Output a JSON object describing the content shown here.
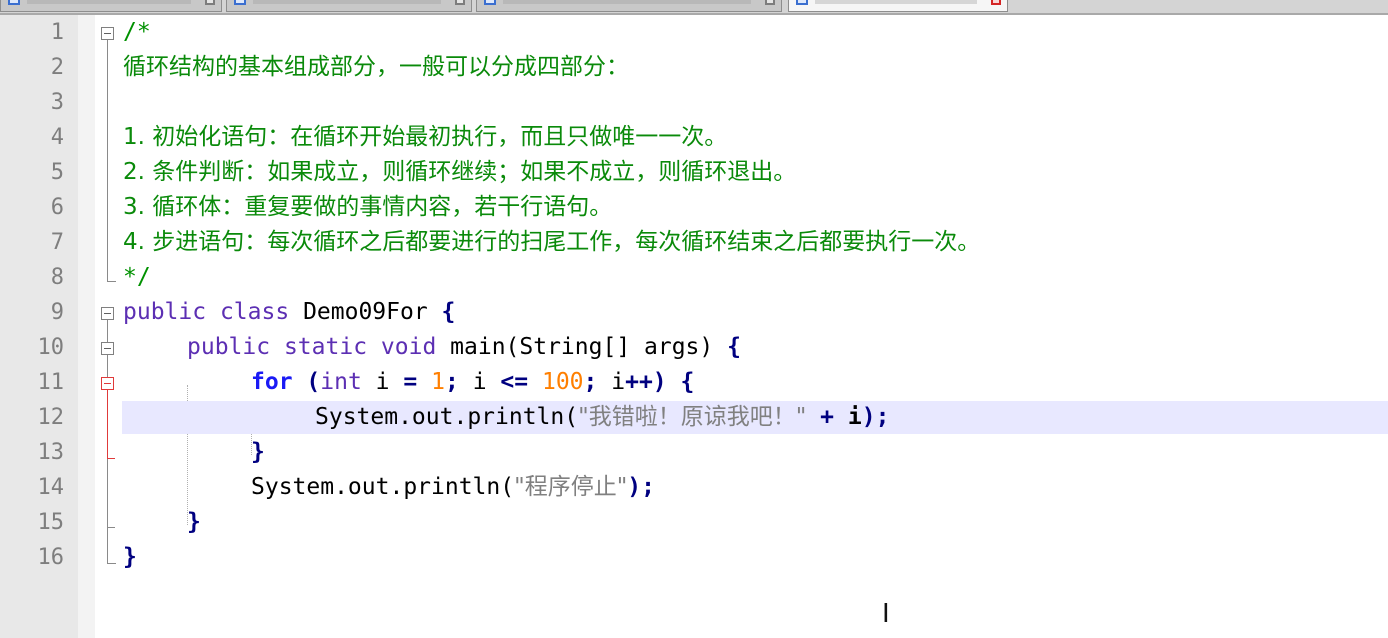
{
  "editor": {
    "lines": [
      {
        "n": "1"
      },
      {
        "n": "2"
      },
      {
        "n": "3"
      },
      {
        "n": "4"
      },
      {
        "n": "5"
      },
      {
        "n": "6"
      },
      {
        "n": "7"
      },
      {
        "n": "8"
      },
      {
        "n": "9"
      },
      {
        "n": "10"
      },
      {
        "n": "11"
      },
      {
        "n": "12"
      },
      {
        "n": "13"
      },
      {
        "n": "14"
      },
      {
        "n": "15"
      },
      {
        "n": "16"
      }
    ],
    "code": {
      "l1": "/*",
      "l2": "循环结构的基本组成部分，一般可以分成四部分：",
      "l4": "1. 初始化语句：在循环开始最初执行，而且只做唯一一次。",
      "l5": "2. 条件判断：如果成立，则循环继续；如果不成立，则循环退出。",
      "l6": "3. 循环体：重复要做的事情内容，若干行语句。",
      "l7": "4. 步进语句：每次循环之后都要进行的扫尾工作，每次循环结束之后都要执行一次。",
      "l8": "*/",
      "l9": {
        "kw1": "public",
        "kw2": "class",
        "name": "Demo09For",
        "brace": "{"
      },
      "l10": {
        "kw1": "public",
        "kw2": "static",
        "kw3": "void",
        "sig": "main(String[] args)",
        "brace": "{"
      },
      "l11": {
        "kw_for": "for",
        "p1": "(",
        "kw_int": "int",
        "a": "i",
        "eq": "=",
        "n1": "1",
        "s1": ";",
        "b": "i",
        "le": "<=",
        "n2": "100",
        "s2": ";",
        "c": "i",
        "inc": "++",
        "p2": ")",
        "brace": "{"
      },
      "l12": {
        "pre": "System.out.println(",
        "str": "\"我错啦！原谅我吧！\"",
        "plus": "+",
        "var": "i",
        "end": ");"
      },
      "l13": "}",
      "l14": {
        "pre": "System.out.println(",
        "str": "\"程序停止\"",
        "end": ");"
      },
      "l15": "}",
      "l16": "}"
    },
    "current_line": "12",
    "colors": {
      "comment": "#009100",
      "keyword": "#5c2fb3",
      "keyword_bold": "#1a1af5",
      "number": "#ff7f00",
      "string": "#808080",
      "current_line_bg": "#e8e8ff",
      "fold_active": "#e03a3a"
    }
  },
  "cursor": {
    "icon": "text-cursor-icon"
  }
}
